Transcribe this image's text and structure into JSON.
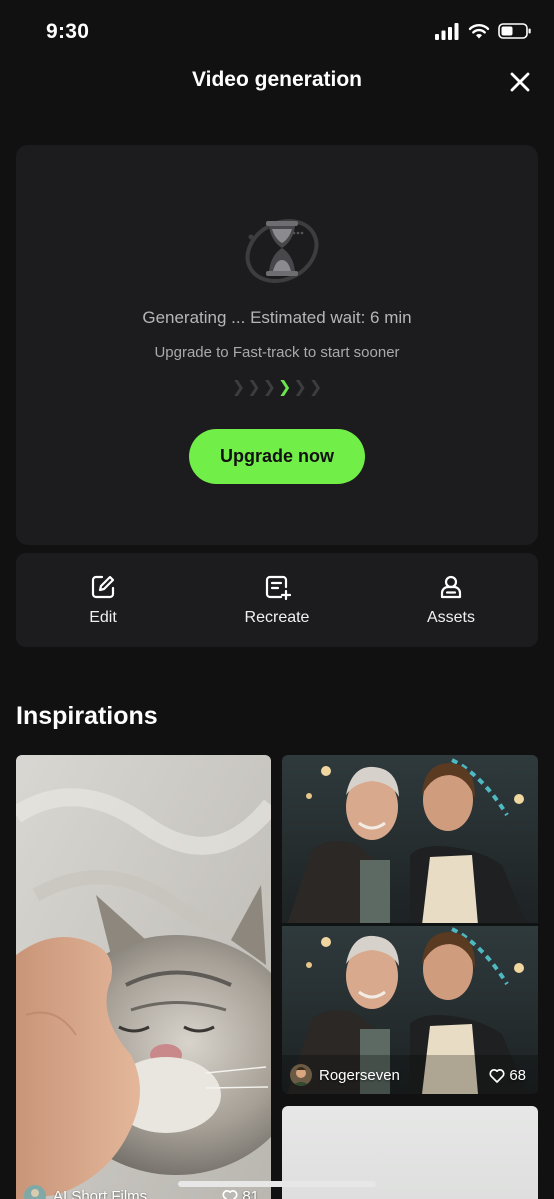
{
  "status_bar": {
    "time": "9:30"
  },
  "header": {
    "title": "Video generation"
  },
  "generation": {
    "status_text": "Generating ... Estimated wait: 6 min",
    "hint_text": "Upgrade to Fast-track to start sooner",
    "upgrade_label": "Upgrade now",
    "accent_color": "#72ee48"
  },
  "actions": [
    {
      "label": "Edit",
      "icon": "edit-icon"
    },
    {
      "label": "Recreate",
      "icon": "recreate-icon"
    },
    {
      "label": "Assets",
      "icon": "assets-icon"
    }
  ],
  "inspirations": {
    "title": "Inspirations",
    "items": [
      {
        "author": "AI Short Films",
        "likes": "81",
        "image": "cat-photo"
      },
      {
        "author": "Rogerseven",
        "likes": "68",
        "image": "two-men-photo"
      },
      {
        "author": "",
        "likes": "",
        "image": "blank-photo"
      }
    ]
  }
}
